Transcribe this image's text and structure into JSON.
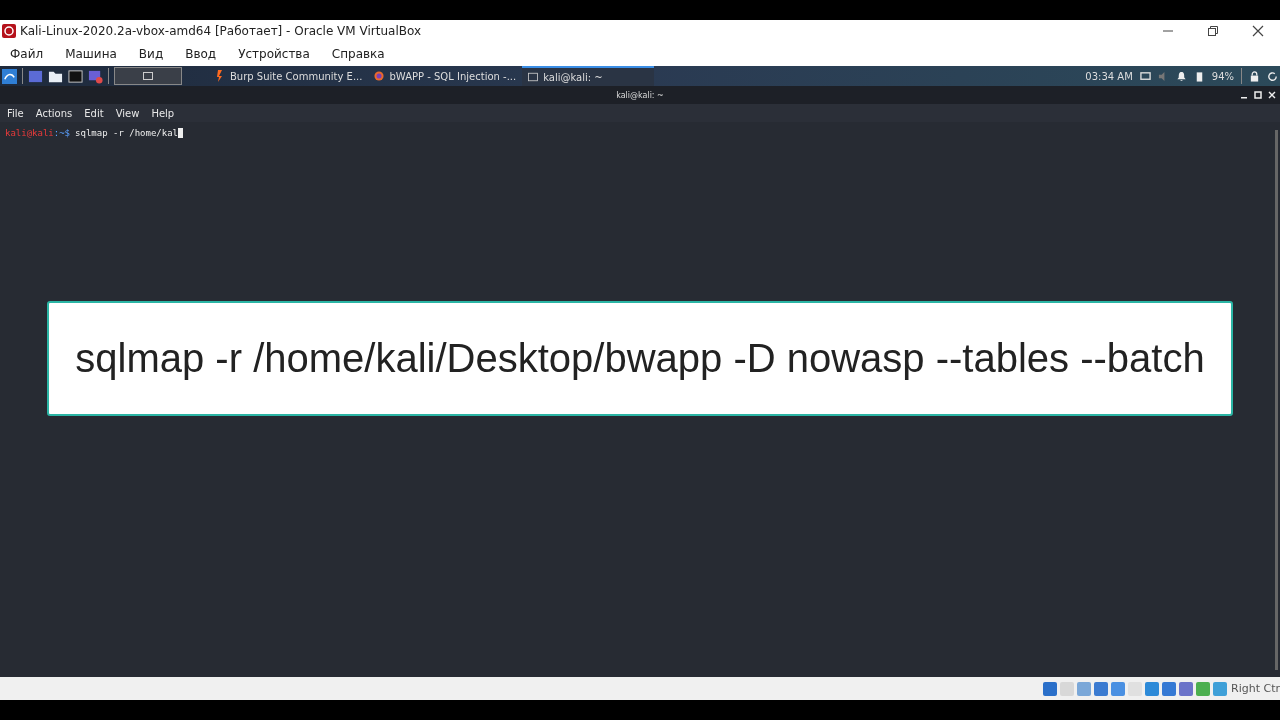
{
  "window": {
    "title": "Kali-Linux-2020.2a-vbox-amd64 [Работает] - Oracle VM VirtualBox"
  },
  "menu": [
    "Файл",
    "Машина",
    "Вид",
    "Ввод",
    "Устройства",
    "Справка"
  ],
  "taskbar": {
    "apps": [
      {
        "label": "Burp Suite Community E...",
        "kind": "burp",
        "selected": false
      },
      {
        "label": "bWAPP - SQL Injection -...",
        "kind": "browser",
        "selected": false
      },
      {
        "label": "kali@kali: ~",
        "kind": "terminal",
        "selected": true
      }
    ],
    "clock": "03:34 AM",
    "battery": "94%"
  },
  "terminal": {
    "title": "kali@kali: ~",
    "menu": [
      "File",
      "Actions",
      "Edit",
      "View",
      "Help"
    ],
    "prompt_user": "kali@kali",
    "prompt_path": ":~$",
    "command": "sqlmap -r /home/kal"
  },
  "overlay": {
    "text": "sqlmap -r /home/kali/Desktop/bwapp -D nowasp --tables --batch"
  },
  "status_bar": {
    "host_key": "Right Ctr"
  }
}
